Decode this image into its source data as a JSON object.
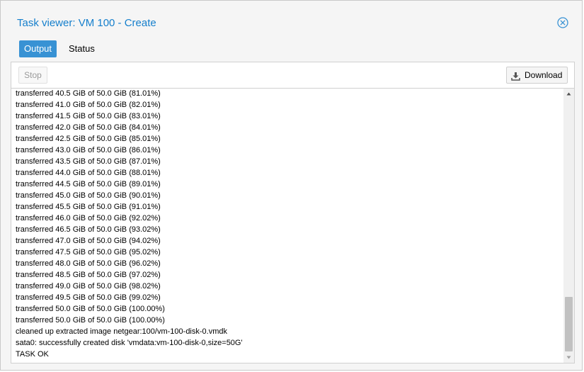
{
  "window": {
    "title": "Task viewer: VM 100 - Create"
  },
  "tabs": [
    {
      "label": "Output"
    },
    {
      "label": "Status"
    }
  ],
  "toolbar": {
    "stop_label": "Stop",
    "download_label": "Download"
  },
  "log": [
    "transferred 40.5 GiB of 50.0 GiB (81.01%)",
    "transferred 41.0 GiB of 50.0 GiB (82.01%)",
    "transferred 41.5 GiB of 50.0 GiB (83.01%)",
    "transferred 42.0 GiB of 50.0 GiB (84.01%)",
    "transferred 42.5 GiB of 50.0 GiB (85.01%)",
    "transferred 43.0 GiB of 50.0 GiB (86.01%)",
    "transferred 43.5 GiB of 50.0 GiB (87.01%)",
    "transferred 44.0 GiB of 50.0 GiB (88.01%)",
    "transferred 44.5 GiB of 50.0 GiB (89.01%)",
    "transferred 45.0 GiB of 50.0 GiB (90.01%)",
    "transferred 45.5 GiB of 50.0 GiB (91.01%)",
    "transferred 46.0 GiB of 50.0 GiB (92.02%)",
    "transferred 46.5 GiB of 50.0 GiB (93.02%)",
    "transferred 47.0 GiB of 50.0 GiB (94.02%)",
    "transferred 47.5 GiB of 50.0 GiB (95.02%)",
    "transferred 48.0 GiB of 50.0 GiB (96.02%)",
    "transferred 48.5 GiB of 50.0 GiB (97.02%)",
    "transferred 49.0 GiB of 50.0 GiB (98.02%)",
    "transferred 49.5 GiB of 50.0 GiB (99.02%)",
    "transferred 50.0 GiB of 50.0 GiB (100.00%)",
    "transferred 50.0 GiB of 50.0 GiB (100.00%)",
    "cleaned up extracted image netgear:100/vm-100-disk-0.vmdk",
    "sata0: successfully created disk 'vmdata:vm-100-disk-0,size=50G'",
    "TASK OK"
  ],
  "icons": {
    "close": "close-circle-icon",
    "download": "download-icon",
    "scroll_up": "triangle-up-icon",
    "scroll_down": "triangle-down-icon"
  },
  "colors": {
    "title": "#157fcc",
    "active_tab": "#3892d4"
  }
}
